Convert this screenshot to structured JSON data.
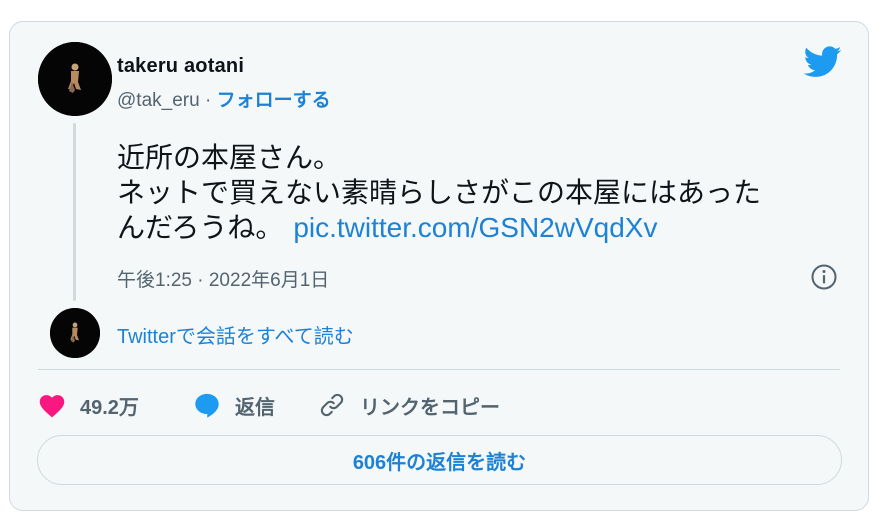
{
  "author": {
    "name": "takeru aotani",
    "handle": "@tak_eru",
    "separator": "·",
    "follow_label": "フォローする"
  },
  "tweet": {
    "lines": [
      "近所の本屋さん。",
      "ネットで買えない素晴らしさがこの本屋にはあった",
      "んだろうね。"
    ],
    "link_text": "pic.twitter.com/GSN2wVqdXv",
    "timestamp": "午後1:25 · 2022年6月1日"
  },
  "conversation_label": "Twitterで会話をすべて読む",
  "actions": {
    "like_count": "49.2万",
    "reply_label": "返信",
    "copy_link_label": "リンクをコピー"
  },
  "read_replies_label": "606件の返信を読む",
  "colors": {
    "accent": "#1d82d6",
    "like": "#f91880",
    "twitter_blue": "#1d9bf0",
    "card_bg": "#f5f8f8",
    "border": "#cfd9de"
  },
  "icons": [
    "twitter-bird-icon",
    "info-icon",
    "heart-icon",
    "reply-bubble-icon",
    "link-icon"
  ]
}
